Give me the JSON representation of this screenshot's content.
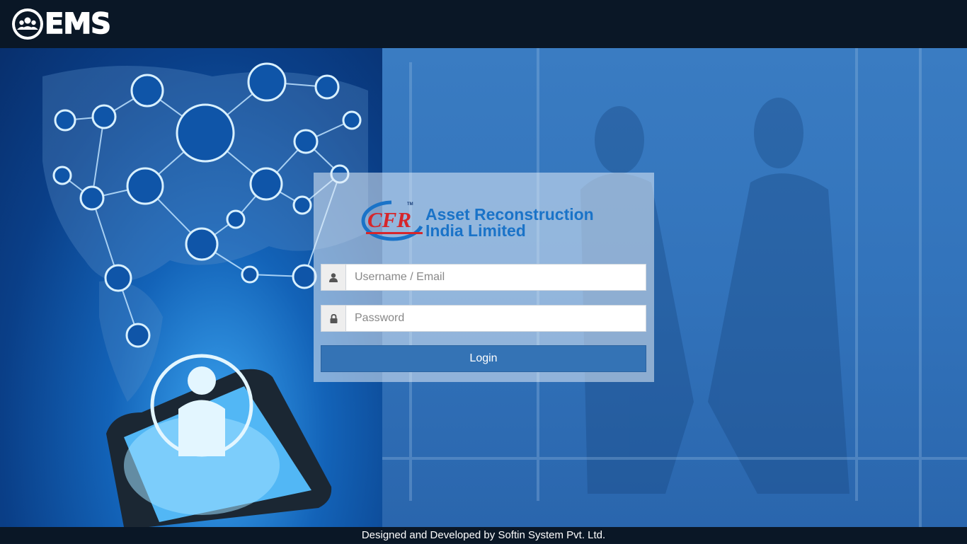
{
  "header": {
    "brand_text": "EMS",
    "brand_icon": "users-group-icon"
  },
  "login": {
    "logo": {
      "mark_text": "CFR",
      "tm_text": "TM",
      "company_line1": "Asset Reconstruction",
      "company_line2": "India Limited"
    },
    "username": {
      "icon": "user-icon",
      "placeholder": "Username / Email",
      "value": ""
    },
    "password": {
      "icon": "lock-icon",
      "placeholder": "Password",
      "value": ""
    },
    "login_label": "Login"
  },
  "footer": {
    "text": "Designed and Developed by Softin System Pvt. Ltd."
  },
  "colors": {
    "topbar": "#0a1726",
    "accent": "#1a73c8",
    "button": "#3473b5",
    "logo_red": "#d6262b"
  }
}
